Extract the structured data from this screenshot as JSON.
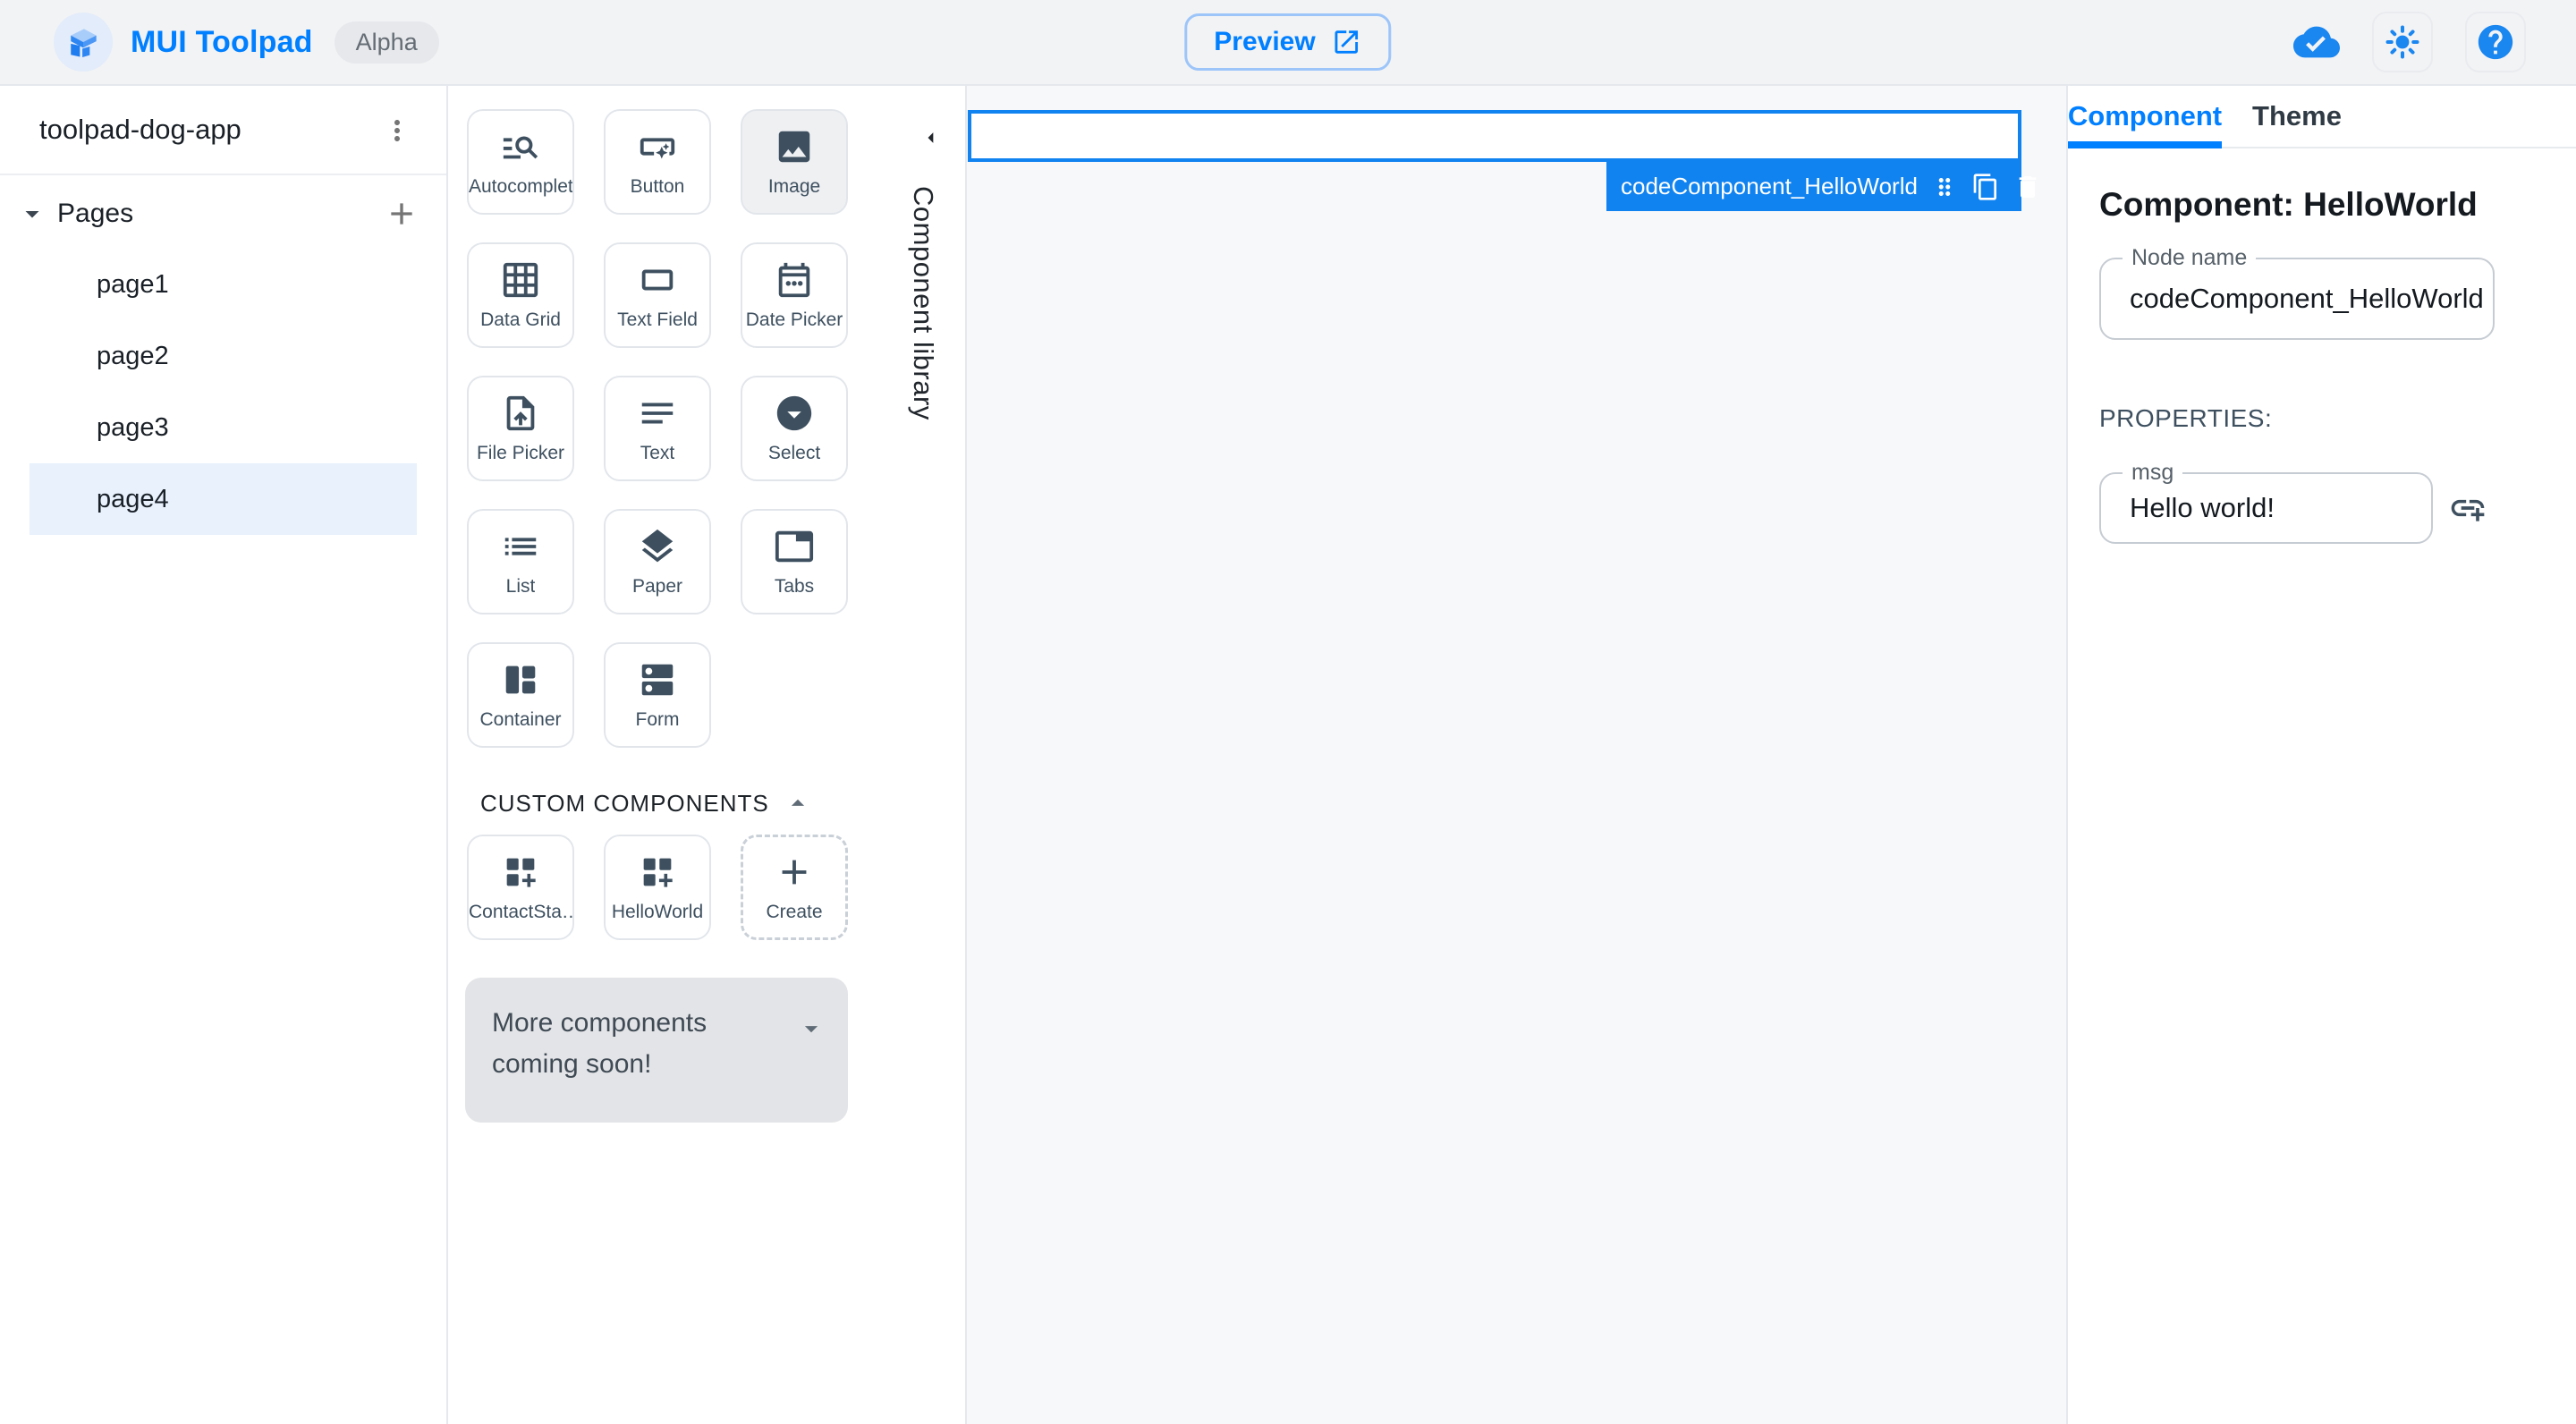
{
  "header": {
    "app_title": "MUI Toolpad",
    "version_badge": "Alpha",
    "preview_button": "Preview"
  },
  "sidebar": {
    "project_name": "toolpad-dog-app",
    "pages_label": "Pages",
    "pages": [
      {
        "label": "page1",
        "selected": false
      },
      {
        "label": "page2",
        "selected": false
      },
      {
        "label": "page3",
        "selected": false
      },
      {
        "label": "page4",
        "selected": true
      }
    ]
  },
  "component_library": {
    "panel_label": "Component library",
    "components": [
      {
        "label": "Autocomplete",
        "icon": "autocomplete-icon",
        "selected": false
      },
      {
        "label": "Button",
        "icon": "button-icon",
        "selected": false
      },
      {
        "label": "Image",
        "icon": "image-icon",
        "selected": true
      },
      {
        "label": "Data Grid",
        "icon": "data-grid-icon",
        "selected": false
      },
      {
        "label": "Text Field",
        "icon": "text-field-icon",
        "selected": false
      },
      {
        "label": "Date Picker",
        "icon": "date-picker-icon",
        "selected": false
      },
      {
        "label": "File Picker",
        "icon": "file-picker-icon",
        "selected": false
      },
      {
        "label": "Text",
        "icon": "text-icon",
        "selected": false
      },
      {
        "label": "Select",
        "icon": "select-icon",
        "selected": false
      },
      {
        "label": "List",
        "icon": "list-icon",
        "selected": false
      },
      {
        "label": "Paper",
        "icon": "paper-icon",
        "selected": false
      },
      {
        "label": "Tabs",
        "icon": "tabs-icon",
        "selected": false
      },
      {
        "label": "Container",
        "icon": "container-icon",
        "selected": false
      },
      {
        "label": "Form",
        "icon": "form-icon",
        "selected": false
      }
    ],
    "custom_section_label": "CUSTOM COMPONENTS",
    "custom_components": [
      {
        "label": "ContactSta…",
        "icon": "custom-component-icon"
      },
      {
        "label": "HelloWorld",
        "icon": "custom-component-icon"
      }
    ],
    "create_label": "Create",
    "coming_soon_text": "More components coming soon!"
  },
  "canvas": {
    "selected_node_label": "codeComponent_HelloWorld"
  },
  "inspector": {
    "tabs": [
      {
        "label": "Component",
        "active": true
      },
      {
        "label": "Theme",
        "active": false
      }
    ],
    "heading": "Component: HelloWorld",
    "node_name": {
      "label": "Node name",
      "value": "codeComponent_HelloWorld"
    },
    "properties_label": "PROPERTIES:",
    "msg": {
      "label": "msg",
      "value": "Hello world!"
    }
  },
  "colors": {
    "brand_blue": "#007FFF",
    "selection_blue": "#1183F0",
    "icon_slate": "#3E5060",
    "canvas_background": "#f7f8f9",
    "selected_page_background": "#e8f1fc"
  }
}
